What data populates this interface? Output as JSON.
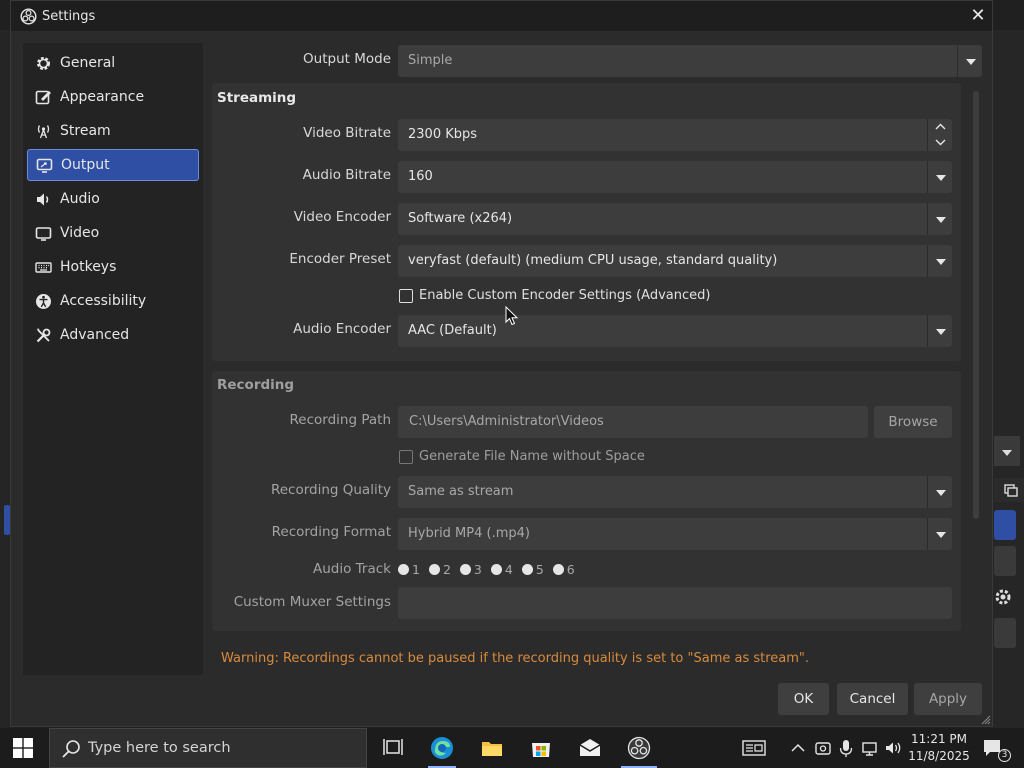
{
  "window": {
    "title": "Settings",
    "close": "✕"
  },
  "sidebar": {
    "items": [
      {
        "label": "General",
        "icon": "gear-icon"
      },
      {
        "label": "Appearance",
        "icon": "palette-icon"
      },
      {
        "label": "Stream",
        "icon": "broadcast-icon"
      },
      {
        "label": "Output",
        "icon": "monitor-icon",
        "active": true
      },
      {
        "label": "Audio",
        "icon": "speaker-icon"
      },
      {
        "label": "Video",
        "icon": "screen-icon"
      },
      {
        "label": "Hotkeys",
        "icon": "keyboard-icon"
      },
      {
        "label": "Accessibility",
        "icon": "accessibility-icon"
      },
      {
        "label": "Advanced",
        "icon": "tools-icon"
      }
    ]
  },
  "output": {
    "mode_label": "Output Mode",
    "mode_value": "Simple",
    "streaming": {
      "title": "Streaming",
      "video_bitrate_label": "Video Bitrate",
      "video_bitrate_value": "2300 Kbps",
      "audio_bitrate_label": "Audio Bitrate",
      "audio_bitrate_value": "160",
      "video_encoder_label": "Video Encoder",
      "video_encoder_value": "Software (x264)",
      "encoder_preset_label": "Encoder Preset",
      "encoder_preset_value": "veryfast (default) (medium CPU usage, standard quality)",
      "custom_encoder_label": "Enable Custom Encoder Settings (Advanced)",
      "custom_encoder_checked": false,
      "audio_encoder_label": "Audio Encoder",
      "audio_encoder_value": "AAC (Default)"
    },
    "recording": {
      "title": "Recording",
      "path_label": "Recording Path",
      "path_value": "C:\\Users\\Administrator\\Videos",
      "browse_label": "Browse",
      "gen_filename_label": "Generate File Name without Space",
      "gen_filename_checked": false,
      "quality_label": "Recording Quality",
      "quality_value": "Same as stream",
      "format_label": "Recording Format",
      "format_value": "Hybrid MP4 (.mp4)",
      "audio_track_label": "Audio Track",
      "audio_tracks": [
        "1",
        "2",
        "3",
        "4",
        "5",
        "6"
      ],
      "muxer_label": "Custom Muxer Settings",
      "muxer_value": ""
    },
    "warning": "Warning: Recordings cannot be paused if the recording quality is set to \"Same as stream\"."
  },
  "buttons": {
    "ok": "OK",
    "cancel": "Cancel",
    "apply": "Apply"
  },
  "taskbar": {
    "search_placeholder": "Type here to search",
    "time": "11:21 PM",
    "date": "11/8/2025",
    "notification_count": "3"
  },
  "colors": {
    "accent": "#2e4fa3",
    "warning": "#d98a3c",
    "window_bg": "#2b2b2b"
  }
}
